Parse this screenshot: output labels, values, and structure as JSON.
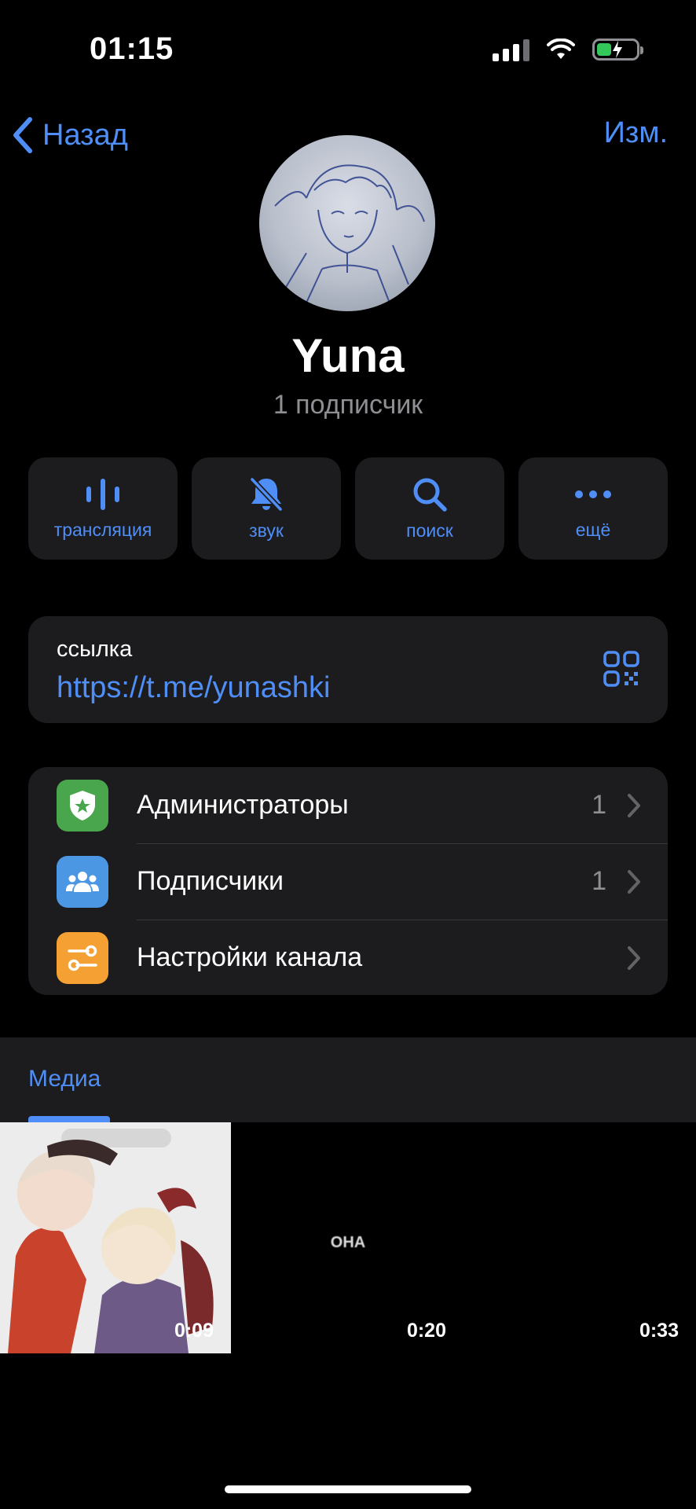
{
  "status_bar": {
    "time": "01:15",
    "battery_color": "#34c759"
  },
  "nav": {
    "back_label": "Назад",
    "edit_label": "Изм."
  },
  "profile": {
    "name": "Yuna",
    "subscribers": "1 подписчик"
  },
  "actions": [
    {
      "label": "трансляция",
      "icon": "broadcast-icon"
    },
    {
      "label": "звук",
      "icon": "bell-muted-icon"
    },
    {
      "label": "поиск",
      "icon": "search-icon"
    },
    {
      "label": "ещё",
      "icon": "more-icon"
    }
  ],
  "link": {
    "caption": "ссылка",
    "url": "https://t.me/yunashki",
    "icon": "qr-code-icon"
  },
  "menu": [
    {
      "label": "Администраторы",
      "count": "1",
      "icon": "admin-badge-icon",
      "color": "#4aa64d"
    },
    {
      "label": "Подписчики",
      "count": "1",
      "icon": "people-icon",
      "color": "#4c97e3"
    },
    {
      "label": "Настройки канала",
      "count": "",
      "icon": "settings-sliders-icon",
      "color": "#f4a033"
    }
  ],
  "media": {
    "tab_label": "Медиа",
    "items": [
      {
        "duration": "0:09",
        "overlay": ""
      },
      {
        "duration": "0:20",
        "overlay": "ОНА"
      },
      {
        "duration": "0:33",
        "overlay": ""
      }
    ]
  },
  "colors": {
    "accent": "#4f8ef7",
    "card": "#1c1c1e",
    "background": "#000000"
  }
}
